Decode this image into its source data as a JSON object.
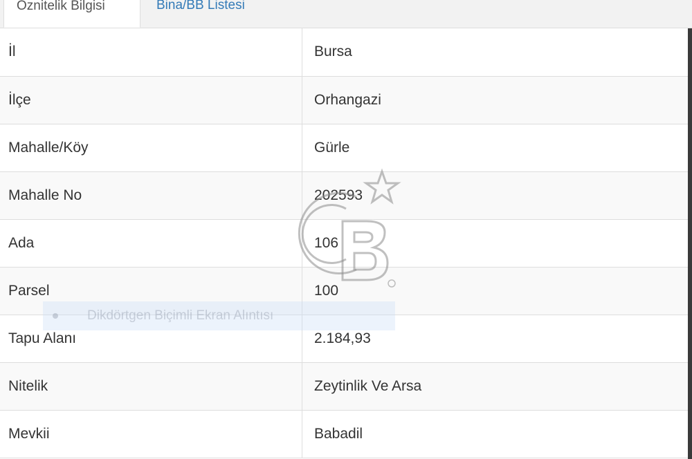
{
  "tabs": [
    {
      "label": "Öznitelik Bilgisi"
    },
    {
      "label": "Bina/BB Listesi"
    }
  ],
  "rows": [
    {
      "key": "İl",
      "value": "Bursa"
    },
    {
      "key": "İlçe",
      "value": "Orhangazi"
    },
    {
      "key": "Mahalle/Köy",
      "value": "Gürle"
    },
    {
      "key": "Mahalle No",
      "value": "202593"
    },
    {
      "key": "Ada",
      "value": "106"
    },
    {
      "key": "Parsel",
      "value": "100"
    },
    {
      "key": "Tapu Alanı",
      "value": "2.184,93"
    },
    {
      "key": "Nitelik",
      "value": "Zeytinlik Ve Arsa"
    },
    {
      "key": "Mevkii",
      "value": "Babadil"
    }
  ],
  "tooltip": {
    "label": "Dikdörtgen Biçimli Ekran Alıntısı"
  },
  "watermark": {
    "text": "CB",
    "registered": "®"
  },
  "colors": {
    "link": "#337ab7",
    "text": "#333333",
    "border": "#dddddd",
    "stripe": "#f9f9f9"
  }
}
